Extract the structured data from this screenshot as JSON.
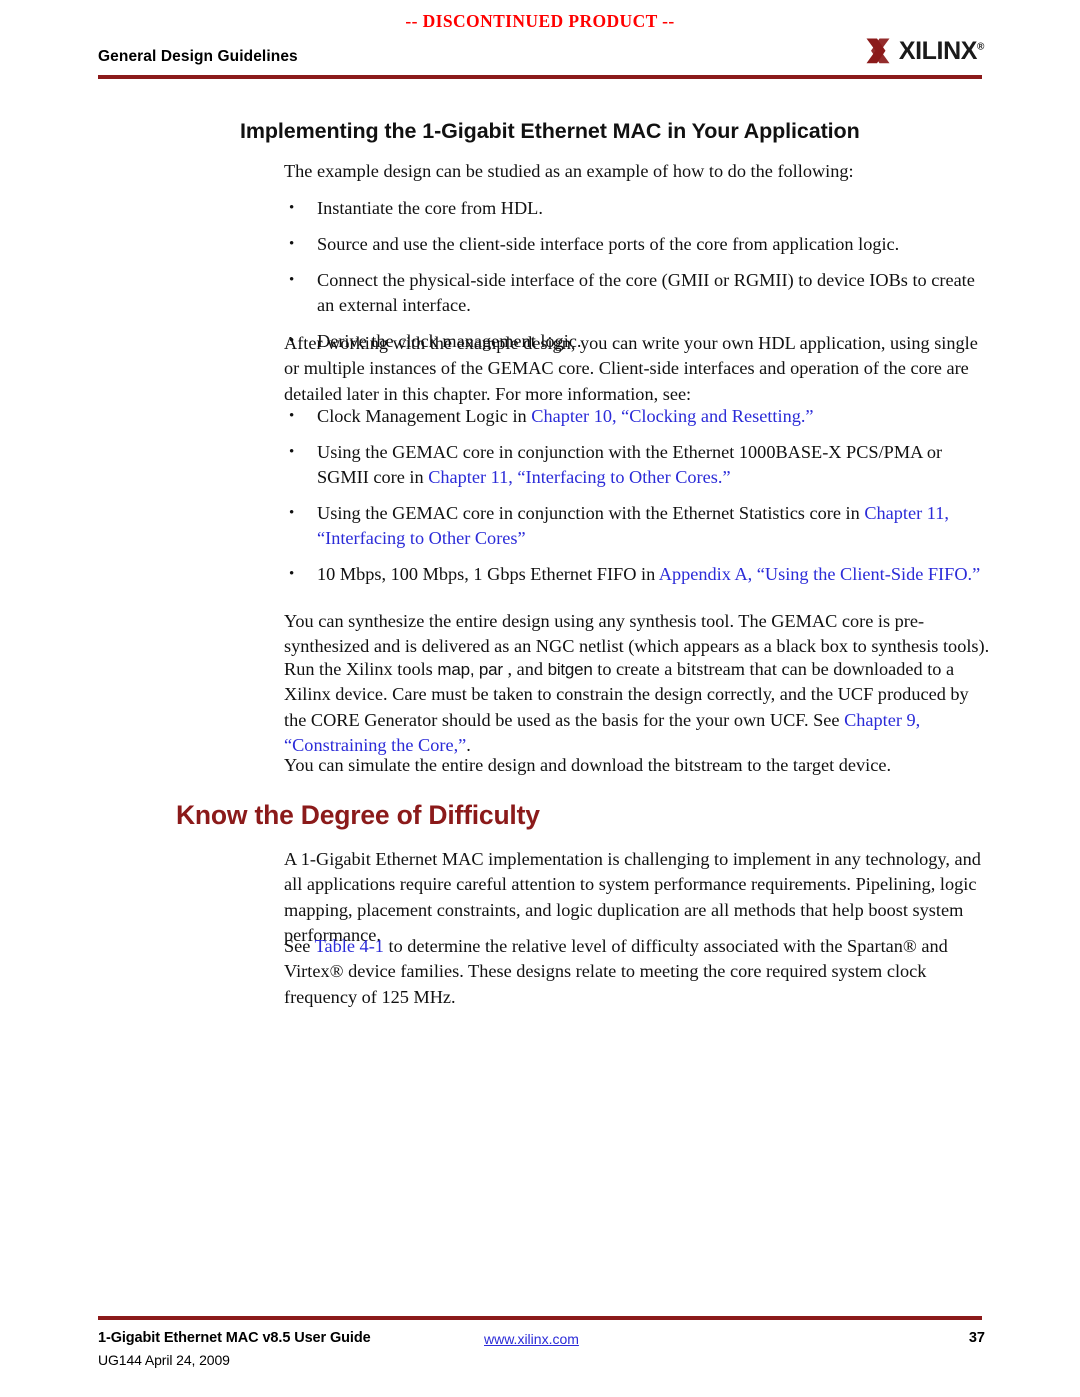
{
  "header": {
    "watermark": "-- DISCONTINUED PRODUCT --",
    "running_title": "General Design Guidelines",
    "logo_word": "XILINX",
    "logo_registered": "®",
    "logo_icon": "xilinx-x-mark",
    "rule_color": "#8b1a1a",
    "watermark_color": "#ff0000"
  },
  "section": {
    "heading": "Implementing the 1-Gigabit Ethernet MAC in Your Application",
    "intro": "The example design can be studied as an example of how to do the following:",
    "bullets_1": [
      "Instantiate the core from HDL.",
      "Source and use the client-side interface ports of the core from application logic.",
      "Connect the physical-side interface of the core (GMII or RGMII) to device IOBs to create an external interface.",
      "Derive the clock management logic."
    ],
    "para_after_bullets": "After working with the example design, you can write your own HDL application, using single or multiple instances of the GEMAC core. Client-side interfaces and operation of the core are detailed later in this chapter. For more information, see:",
    "bullets_2": [
      {
        "pre": "Clock Management Logic in ",
        "link": "Chapter 10, “Clocking and Resetting.”",
        "post": ""
      },
      {
        "pre": "Using the GEMAC core in conjunction with the Ethernet 1000BASE-X PCS/PMA or SGMII core in ",
        "link": "Chapter 11, “Interfacing to Other Cores.”",
        "post": ""
      },
      {
        "pre": "Using the GEMAC core in conjunction with the Ethernet Statistics core in ",
        "link": "Chapter 11, “Interfacing to Other Cores”",
        "post": ""
      },
      {
        "pre": "10 Mbps, 100 Mbps, 1 Gbps Ethernet FIFO in ",
        "link": "Appendix A, “Using the Client-Side FIFO.”",
        "post": ""
      }
    ],
    "para_synthesize": "You can synthesize the entire design using any synthesis tool. The GEMAC core is pre-synthesized and is delivered as an NGC netlist (which appears as a black box to synthesis tools).",
    "para_run": {
      "part_1": "Run the Xilinx tools ",
      "tool_1": "map, par",
      "part_2": " , and ",
      "tool_2": "bitgen",
      "part_3": " to create a bitstream that can be downloaded to a Xilinx device. Care must be taken to constrain the design correctly, and the UCF produced by the CORE Generator should be used as the basis for the your own UCF. See ",
      "link": "Chapter 9, “Constraining the Core,”",
      "part_4": "."
    },
    "para_simulate": "You can simulate the entire design and download the bitstream to the target device."
  },
  "chapter": {
    "heading": "Know the Degree of Difficulty",
    "heading_color": "#8b1a1a",
    "para_1": "A 1-Gigabit Ethernet MAC implementation is challenging to implement in any technology, and all applications require careful attention to system performance requirements. Pipelining, logic mapping, placement constraints, and logic duplication are all methods that help boost system performance.",
    "para_2": {
      "part_1": "See ",
      "link": "Table 4-1",
      "part_2": " to determine the relative level of difficulty associated with the Spartan® and Virtex® device families. These designs relate to meeting the core required system clock frequency of 125 MHz."
    }
  },
  "footer": {
    "title": "1-Gigabit Ethernet MAC v8.5 User Guide",
    "link": "www.xilinx.com",
    "page_number": "37",
    "doc_id": "UG144 April 24, 2009",
    "link_color": "#2b2bd8"
  },
  "bullet_glyph": "•"
}
